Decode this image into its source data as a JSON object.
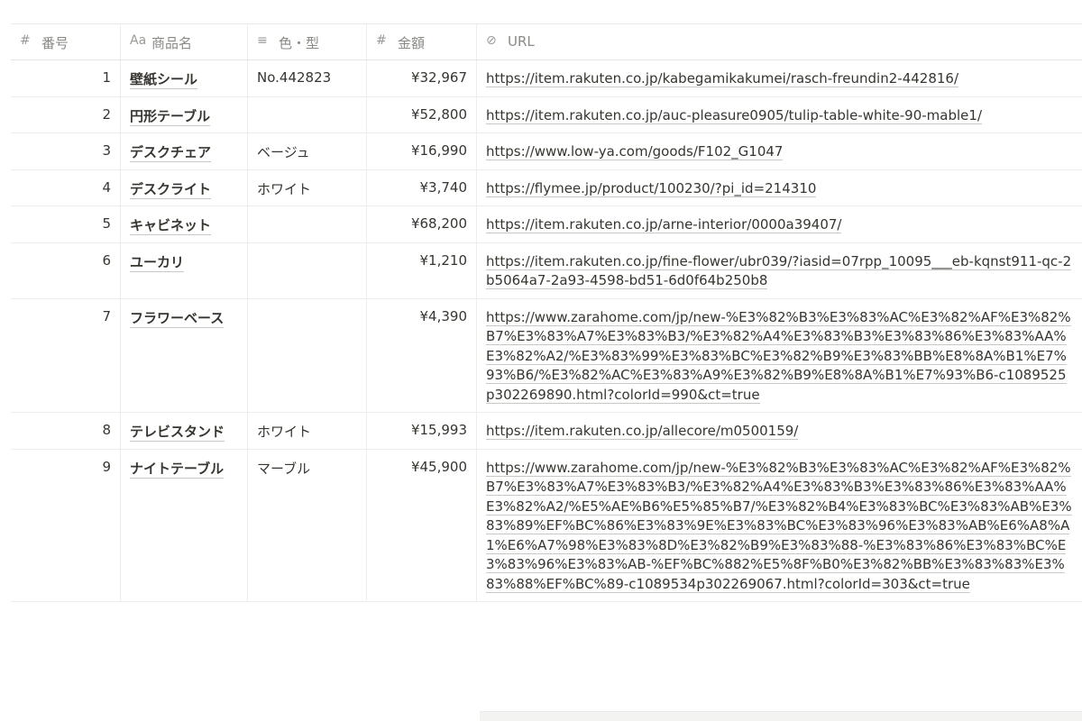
{
  "columns": {
    "num": {
      "label": "番号",
      "icon": "#"
    },
    "name": {
      "label": "商品名",
      "icon": "Aa"
    },
    "color": {
      "label": "色・型",
      "icon": "≡"
    },
    "price": {
      "label": "金額",
      "icon": "#"
    },
    "url": {
      "label": "URL",
      "icon": "⊘"
    }
  },
  "rows": [
    {
      "num": "1",
      "name": "壁紙シール",
      "color": "No.442823",
      "price": "¥32,967",
      "url": "https://item.rakuten.co.jp/kabegamikakumei/rasch-freundin2-442816/"
    },
    {
      "num": "2",
      "name": "円形テーブル",
      "color": "",
      "price": "¥52,800",
      "url": "https://item.rakuten.co.jp/auc-pleasure0905/tulip-table-white-90-mable1/"
    },
    {
      "num": "3",
      "name": "デスクチェア",
      "color": "ベージュ",
      "price": "¥16,990",
      "url": "https://www.low-ya.com/goods/F102_G1047"
    },
    {
      "num": "4",
      "name": "デスクライト",
      "color": "ホワイト",
      "price": "¥3,740",
      "url": "https://flymee.jp/product/100230/?pi_id=214310"
    },
    {
      "num": "5",
      "name": "キャビネット",
      "color": "",
      "price": "¥68,200",
      "url": "https://item.rakuten.co.jp/arne-interior/0000a39407/"
    },
    {
      "num": "6",
      "name": "ユーカリ",
      "color": "",
      "price": "¥1,210",
      "url": "https://item.rakuten.co.jp/fine-flower/ubr039/?iasid=07rpp_10095___eb-kqnst911-qc-2b5064a7-2a93-4598-bd51-6d0f64b250b8"
    },
    {
      "num": "7",
      "name": "フラワーベース",
      "color": "",
      "price": "¥4,390",
      "url": "https://www.zarahome.com/jp/new-%E3%82%B3%E3%83%AC%E3%82%AF%E3%82%B7%E3%83%A7%E3%83%B3/%E3%82%A4%E3%83%B3%E3%83%86%E3%83%AA%E3%82%A2/%E3%83%99%E3%83%BC%E3%82%B9%E3%83%BB%E8%8A%B1%E7%93%B6/%E3%82%AC%E3%83%A9%E3%82%B9%E8%8A%B1%E7%93%B6-c1089525p302269890.html?colorId=990&ct=true"
    },
    {
      "num": "8",
      "name": "テレビスタンド",
      "color": "ホワイト",
      "price": "¥15,993",
      "url": "https://item.rakuten.co.jp/allecore/m0500159/"
    },
    {
      "num": "9",
      "name": "ナイトテーブル",
      "color": "マーブル",
      "price": "¥45,900",
      "url": "https://www.zarahome.com/jp/new-%E3%82%B3%E3%83%AC%E3%82%AF%E3%82%B7%E3%83%A7%E3%83%B3/%E3%82%A4%E3%83%B3%E3%83%86%E3%83%AA%E3%82%A2/%E5%AE%B6%E5%85%B7/%E3%82%B4%E3%83%BC%E3%83%AB%E3%83%89%EF%BC%86%E3%83%9E%E3%83%BC%E3%83%96%E3%83%AB%E6%A8%A1%E6%A7%98%E3%83%8D%E3%82%B9%E3%83%88-%E3%83%86%E3%83%BC%E3%83%96%E3%83%AB-%EF%BC%882%E5%8F%B0%E3%82%BB%E3%83%83%E3%83%88%EF%BC%89-c1089534p302269067.html?colorId=303&ct=true"
    }
  ]
}
